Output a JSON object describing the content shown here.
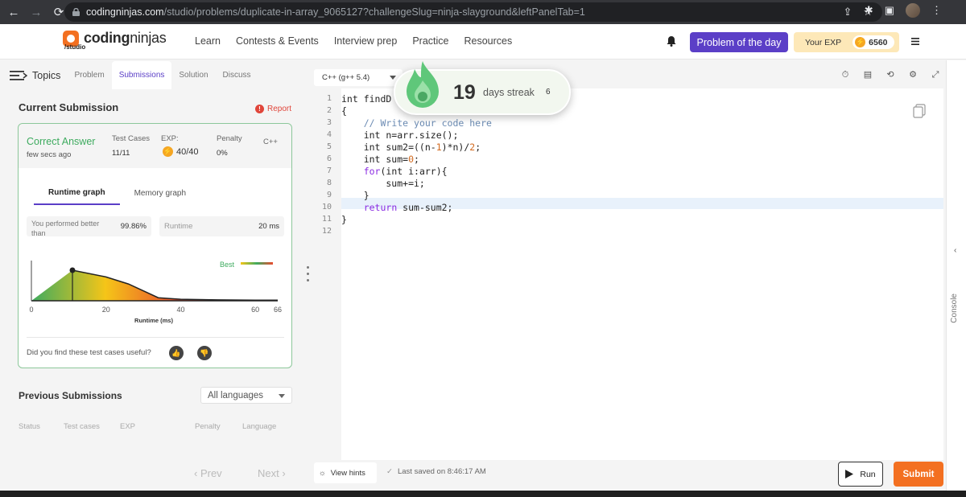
{
  "browser": {
    "url_host": "codingninjas.com",
    "url_path": "/studio/problems/duplicate-in-array_9065127?challengeSlug=ninja-slayground&leftPanelTab=1"
  },
  "header": {
    "logo_bold": "coding",
    "logo_light": "ninjas",
    "logo_sub": "/studio",
    "nav": [
      "Learn",
      "Contests & Events",
      "Interview prep",
      "Practice",
      "Resources"
    ],
    "potd_label": "Problem of the day",
    "exp_label": "Your EXP",
    "exp_value": "6560"
  },
  "left_panel": {
    "topics_label": "Topics",
    "tabs": [
      "Problem",
      "Submissions",
      "Solution",
      "Discuss"
    ],
    "current_title": "Current Submission",
    "report_label": "Report",
    "submission": {
      "status": "Correct Answer",
      "time": "few secs ago",
      "test_cases_label": "Test Cases",
      "test_cases_value": "11/11",
      "exp_label": "EXP:",
      "exp_value": "40/40",
      "penalty_label": "Penalty",
      "penalty_value": "0%",
      "language": "C++"
    },
    "graph_tabs": [
      "Runtime graph",
      "Memory graph"
    ],
    "perf_label": "You performed better than",
    "perf_value": "99.86%",
    "runtime_label": "Runtime",
    "runtime_value": "20 ms",
    "feedback_q": "Did you find these test cases useful?",
    "prev_title": "Previous Submissions",
    "lang_filter": "All languages",
    "columns": [
      "Status",
      "Test cases",
      "EXP",
      "Penalty",
      "Language"
    ],
    "prev_label": "Prev",
    "next_label": "Next"
  },
  "chart_data": {
    "type": "area",
    "xlabel": "Runtime (ms)",
    "ylabel": "",
    "x_ticks": [
      0,
      20,
      40,
      60,
      66
    ],
    "xlim": [
      0,
      66
    ],
    "legend": "Best",
    "legend_position": "top-right",
    "marker_x": 11,
    "x": [
      0,
      11,
      20,
      26,
      34,
      40,
      50,
      60,
      66
    ],
    "y": [
      0,
      1.0,
      0.78,
      0.55,
      0.1,
      0.05,
      0.03,
      0.02,
      0.02
    ],
    "colors": [
      "#3eab5f",
      "#f5c518",
      "#e94b2f"
    ]
  },
  "editor": {
    "language": "C++ (g++ 5.4)",
    "line_numbers": [
      "1",
      "2",
      "3",
      "4",
      "5",
      "6",
      "7",
      "8",
      "9",
      "10",
      "11",
      "12"
    ],
    "view_hints": "View hints",
    "last_saved": "Last saved on 8:46:17 AM",
    "run_label": "Run",
    "submit_label": "Submit",
    "console_label": "Console"
  },
  "streak": {
    "days": "19",
    "label": "days streak",
    "count": "6"
  }
}
